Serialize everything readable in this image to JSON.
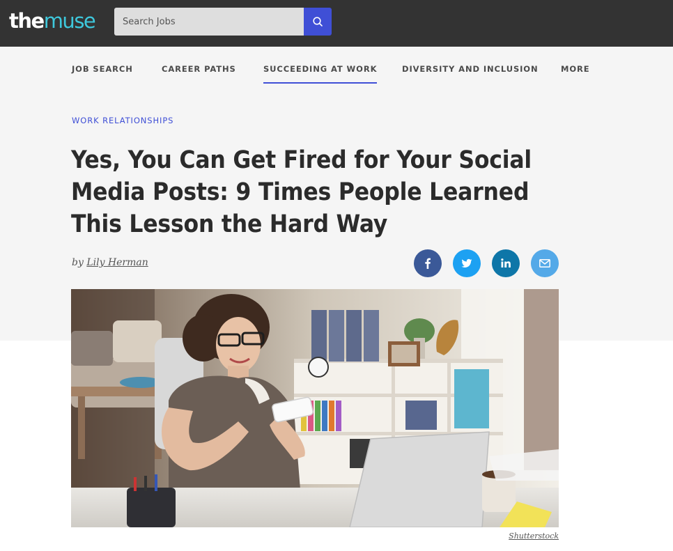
{
  "header": {
    "logo_the": "the",
    "logo_muse": "muse",
    "search_placeholder": "Search Jobs"
  },
  "nav": [
    {
      "label": "JOB SEARCH",
      "active": false
    },
    {
      "label": "CAREER PATHS",
      "active": false
    },
    {
      "label": "SUCCEEDING AT WORK",
      "active": true
    },
    {
      "label": "DIVERSITY AND INCLUSION",
      "active": false
    },
    {
      "label": "MORE",
      "active": false
    }
  ],
  "article": {
    "category": "WORK RELATIONSHIPS",
    "headline": "Yes, You Can Get Fired for Your Social Media Posts: 9 Times People Learned This Lesson the Hard Way",
    "byline_prefix": "by",
    "author": "Lily Herman",
    "image_credit": "Shutterstock"
  },
  "share": [
    "facebook-icon",
    "twitter-icon",
    "linkedin-icon",
    "email-icon"
  ],
  "colors": {
    "topbar": "#333333",
    "accent": "#3f4fd6",
    "logo_muse": "#3ec8dc",
    "facebook": "#3b5998",
    "twitter": "#1da1f2",
    "linkedin": "#0e76a8",
    "email": "#54a9e8"
  }
}
